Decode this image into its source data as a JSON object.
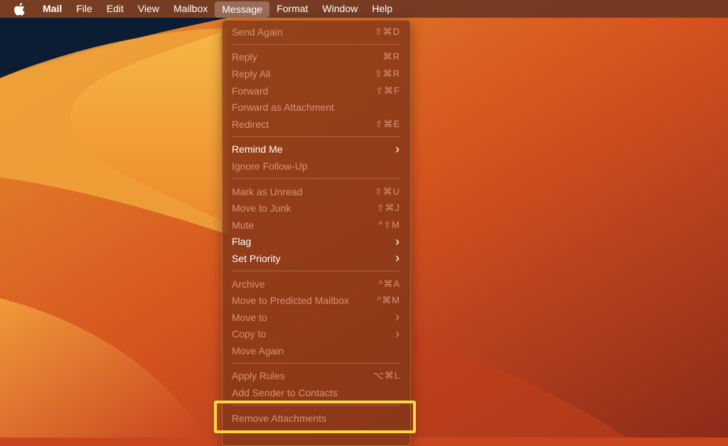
{
  "menubar": {
    "items": [
      "Mail",
      "File",
      "Edit",
      "View",
      "Mailbox",
      "Message",
      "Format",
      "Window",
      "Help"
    ],
    "active": "Message"
  },
  "menu": {
    "groups": [
      [
        {
          "label": "Send Again",
          "shortcut": "⇧⌘D",
          "enabled": false
        }
      ],
      [
        {
          "label": "Reply",
          "shortcut": "⌘R",
          "enabled": false
        },
        {
          "label": "Reply All",
          "shortcut": "⇧⌘R",
          "enabled": false
        },
        {
          "label": "Forward",
          "shortcut": "⇧⌘F",
          "enabled": false
        },
        {
          "label": "Forward as Attachment",
          "shortcut": "",
          "enabled": false
        },
        {
          "label": "Redirect",
          "shortcut": "⇧⌘E",
          "enabled": false
        }
      ],
      [
        {
          "label": "Remind Me",
          "shortcut": "›",
          "enabled": true
        },
        {
          "label": "Ignore Follow-Up",
          "shortcut": "",
          "enabled": false
        }
      ],
      [
        {
          "label": "Mark as Unread",
          "shortcut": "⇧⌘U",
          "enabled": false
        },
        {
          "label": "Move to Junk",
          "shortcut": "⇧⌘J",
          "enabled": false
        },
        {
          "label": "Mute",
          "shortcut": "^⇧M",
          "enabled": false
        },
        {
          "label": "Flag",
          "shortcut": "›",
          "enabled": true
        },
        {
          "label": "Set Priority",
          "shortcut": "›",
          "enabled": true
        }
      ],
      [
        {
          "label": "Archive",
          "shortcut": "^⌘A",
          "enabled": false
        },
        {
          "label": "Move to Predicted Mailbox",
          "shortcut": "^⌘M",
          "enabled": false
        },
        {
          "label": "Move to",
          "shortcut": "›",
          "enabled": false
        },
        {
          "label": "Copy to",
          "shortcut": "›",
          "enabled": false
        },
        {
          "label": "Move Again",
          "shortcut": "",
          "enabled": false
        }
      ],
      [
        {
          "label": "Apply Rules",
          "shortcut": "⌥⌘L",
          "enabled": false
        },
        {
          "label": "Add Sender to Contacts",
          "shortcut": "",
          "enabled": false
        }
      ],
      [
        {
          "label": "Remove Attachments",
          "shortcut": "",
          "enabled": false
        }
      ]
    ]
  },
  "colors": {
    "highlight": "#f8d74a"
  }
}
